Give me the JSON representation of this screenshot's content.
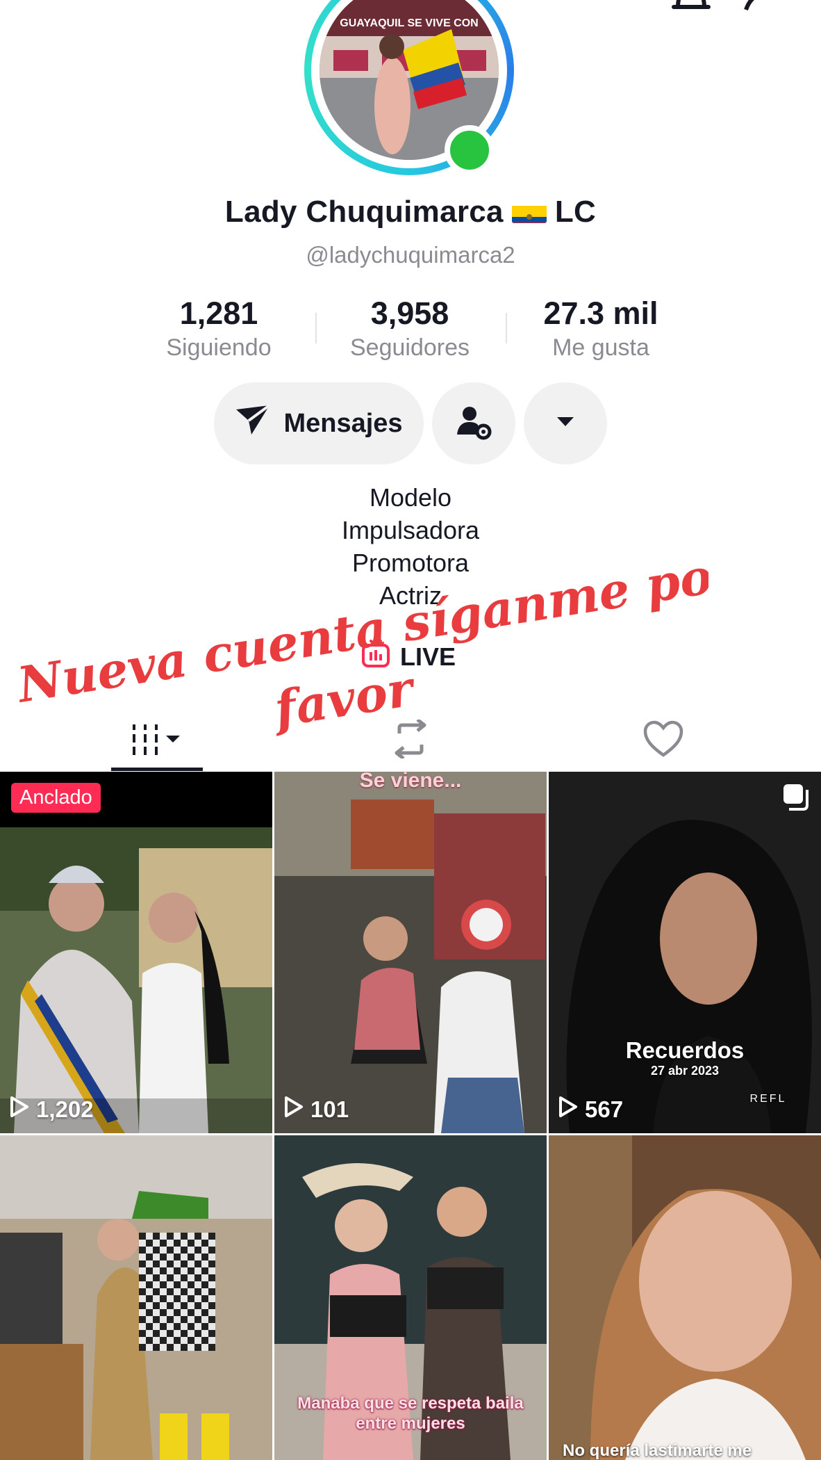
{
  "profile": {
    "display_name_before": "Lady Chuquimarca",
    "display_name_after": "LC",
    "handle": "@ladychuquimarca2",
    "avatar_sign_text": "GUAYAQUIL SE VIVE CON",
    "online_color": "#28c33f"
  },
  "stats": [
    {
      "value": "1,281",
      "label": "Siguiendo"
    },
    {
      "value": "3,958",
      "label": "Seguidores"
    },
    {
      "value": "27.3 mil",
      "label": "Me gusta"
    }
  ],
  "actions": {
    "message_label": "Mensajes",
    "friend_icon": "person-gear-icon",
    "more_icon": "caret-down-icon"
  },
  "bio": [
    "Modelo",
    "Impulsadora",
    "Promotora",
    "Actriz"
  ],
  "live_label": "LIVE",
  "overlay_caption": {
    "line1": "Nueva cuenta  síganme por",
    "line2": "favor",
    "color": "#e83c3f"
  },
  "tabs": [
    {
      "icon": "videos-grid-icon",
      "active": true
    },
    {
      "icon": "repost-icon",
      "active": false
    },
    {
      "icon": "heart-icon",
      "active": false
    }
  ],
  "videos": [
    {
      "views": "1,202",
      "badge": "Anclado",
      "caption": ""
    },
    {
      "views": "101",
      "caption": "Se viene..."
    },
    {
      "views": "567",
      "caption": "Recuerdos",
      "subcaption": "27 abr 2023",
      "corner_text": "REFL"
    },
    {
      "views": "",
      "caption": ""
    },
    {
      "views": "",
      "caption": "Manaba que se respeta baila entre mujeres"
    },
    {
      "views": "",
      "caption": "No quería lastimarte me"
    }
  ],
  "colors": {
    "accent": "#fe2c55",
    "ring": "#25c8e0",
    "muted_text": "#8a8b91",
    "button_bg": "#f1f1f2"
  }
}
